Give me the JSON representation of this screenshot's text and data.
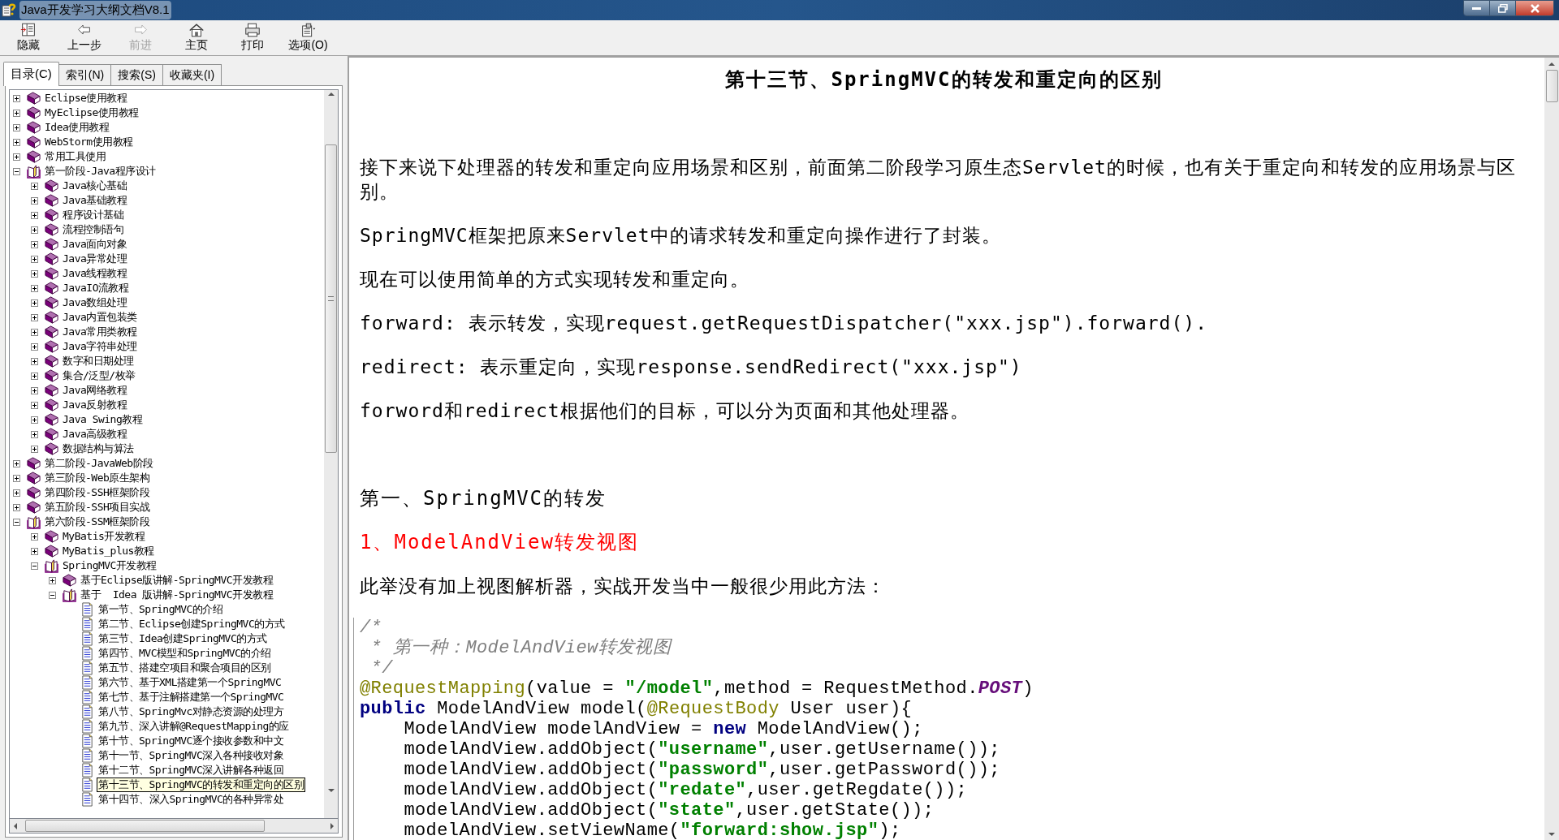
{
  "window": {
    "title": "Java开发学习大纲文档V8.1"
  },
  "toolbar": [
    {
      "kind": "hide",
      "label": "隐藏",
      "disabled": false
    },
    {
      "kind": "back",
      "label": "上一步",
      "disabled": false
    },
    {
      "kind": "forward",
      "label": "前进",
      "disabled": true
    },
    {
      "kind": "home",
      "label": "主页",
      "disabled": false
    },
    {
      "kind": "print",
      "label": "打印",
      "disabled": false
    },
    {
      "kind": "options",
      "label": "选项(O)",
      "disabled": false
    }
  ],
  "nav_tabs": [
    {
      "label": "目录(C)",
      "selected": true
    },
    {
      "label": "索引(N)",
      "selected": false
    },
    {
      "label": "搜索(S)",
      "selected": false
    },
    {
      "label": "收藏夹(I)",
      "selected": false
    }
  ],
  "tree": [
    {
      "label": "Eclipse使用教程",
      "kind": "book",
      "expanded": false,
      "selected": false
    },
    {
      "label": "MyEclipse使用教程",
      "kind": "book",
      "expanded": false,
      "selected": false
    },
    {
      "label": "Idea使用教程",
      "kind": "book",
      "expanded": false,
      "selected": false
    },
    {
      "label": "WebStorm使用教程",
      "kind": "book",
      "expanded": false,
      "selected": false
    },
    {
      "label": "常用工具使用",
      "kind": "book",
      "expanded": false,
      "selected": false
    },
    {
      "label": "第一阶段-Java程序设计",
      "kind": "book",
      "expanded": true,
      "selected": false,
      "children": [
        {
          "label": "Java核心基础",
          "kind": "book",
          "expanded": false,
          "selected": false
        },
        {
          "label": "Java基础教程",
          "kind": "book",
          "expanded": false,
          "selected": false
        },
        {
          "label": "程序设计基础",
          "kind": "book",
          "expanded": false,
          "selected": false
        },
        {
          "label": "流程控制语句",
          "kind": "book",
          "expanded": false,
          "selected": false
        },
        {
          "label": "Java面向对象",
          "kind": "book",
          "expanded": false,
          "selected": false
        },
        {
          "label": "Java异常处理",
          "kind": "book",
          "expanded": false,
          "selected": false
        },
        {
          "label": "Java线程教程",
          "kind": "book",
          "expanded": false,
          "selected": false
        },
        {
          "label": "JavaIO流教程",
          "kind": "book",
          "expanded": false,
          "selected": false
        },
        {
          "label": "Java数组处理",
          "kind": "book",
          "expanded": false,
          "selected": false
        },
        {
          "label": "Java内置包装类",
          "kind": "book",
          "expanded": false,
          "selected": false
        },
        {
          "label": "Java常用类教程",
          "kind": "book",
          "expanded": false,
          "selected": false
        },
        {
          "label": "Java字符串处理",
          "kind": "book",
          "expanded": false,
          "selected": false
        },
        {
          "label": "数字和日期处理",
          "kind": "book",
          "expanded": false,
          "selected": false
        },
        {
          "label": "集合/泛型/枚举",
          "kind": "book",
          "expanded": false,
          "selected": false
        },
        {
          "label": "Java网络教程",
          "kind": "book",
          "expanded": false,
          "selected": false
        },
        {
          "label": "Java反射教程",
          "kind": "book",
          "expanded": false,
          "selected": false
        },
        {
          "label": "Java Swing教程",
          "kind": "book",
          "expanded": false,
          "selected": false
        },
        {
          "label": "Java高级教程",
          "kind": "book",
          "expanded": false,
          "selected": false
        },
        {
          "label": "数据结构与算法",
          "kind": "book",
          "expanded": false,
          "selected": false
        }
      ]
    },
    {
      "label": "第二阶段-JavaWeb阶段",
      "kind": "book",
      "expanded": false,
      "selected": false
    },
    {
      "label": "第三阶段-Web原生架构",
      "kind": "book",
      "expanded": false,
      "selected": false
    },
    {
      "label": "第四阶段-SSH框架阶段",
      "kind": "book",
      "expanded": false,
      "selected": false
    },
    {
      "label": "第五阶段-SSH项目实战",
      "kind": "book",
      "expanded": false,
      "selected": false
    },
    {
      "label": "第六阶段-SSM框架阶段",
      "kind": "book",
      "expanded": true,
      "selected": false,
      "children": [
        {
          "label": "MyBatis开发教程",
          "kind": "book",
          "expanded": false,
          "selected": false
        },
        {
          "label": "MyBatis_plus教程",
          "kind": "book",
          "expanded": false,
          "selected": false
        },
        {
          "label": "SpringMVC开发教程",
          "kind": "book",
          "expanded": true,
          "selected": false,
          "children": [
            {
              "label": "基于Eclipse版讲解-SpringMVC开发教程",
              "kind": "book",
              "expanded": false,
              "selected": false
            },
            {
              "label": "基于  Idea 版讲解-SpringMVC开发教程",
              "kind": "book",
              "expanded": true,
              "selected": false,
              "children": [
                {
                  "label": "第一节、SpringMVC的介绍",
                  "kind": "page",
                  "selected": false
                },
                {
                  "label": "第二节、Eclipse创建SpringMVC的方式",
                  "kind": "page",
                  "selected": false
                },
                {
                  "label": "第三节、Idea创建SpringMVC的方式",
                  "kind": "page",
                  "selected": false
                },
                {
                  "label": "第四节、MVC模型和SpringMVC的介绍",
                  "kind": "page",
                  "selected": false
                },
                {
                  "label": "第五节、搭建空项目和聚合项目的区别",
                  "kind": "page",
                  "selected": false
                },
                {
                  "label": "第六节、基于XML搭建第一个SpringMVC",
                  "kind": "page",
                  "selected": false
                },
                {
                  "label": "第七节、基于注解搭建第一个SpringMVC",
                  "kind": "page",
                  "selected": false
                },
                {
                  "label": "第八节、SpringMvc对静态资源的处理方",
                  "kind": "page",
                  "selected": false
                },
                {
                  "label": "第九节、深入讲解@RequestMapping的应",
                  "kind": "page",
                  "selected": false
                },
                {
                  "label": "第十节、SpringMVC逐个接收参数和中文",
                  "kind": "page",
                  "selected": false
                },
                {
                  "label": "第十一节、SpringMVC深入各种接收对象",
                  "kind": "page",
                  "selected": false
                },
                {
                  "label": "第十二节、SpringMVC深入讲解各种返回",
                  "kind": "page",
                  "selected": false
                },
                {
                  "label": "第十三节、SpringMVC的转发和重定向的区别",
                  "kind": "page",
                  "selected": true
                },
                {
                  "label": "第十四节、深入SpringMVC的各种异常处",
                  "kind": "page",
                  "selected": false
                }
              ]
            }
          ]
        }
      ]
    }
  ],
  "content": {
    "title": "第十三节、SpringMVC的转发和重定向的区别",
    "blocks": [
      {
        "kind": "para",
        "text": "接下来说下处理器的转发和重定向应用场景和区别，前面第二阶段学习原生态Servlet的时候，也有关于重定向和转发的应用场景与区别。"
      },
      {
        "kind": "para",
        "text": "SpringMVC框架把原来Servlet中的请求转发和重定向操作进行了封装。"
      },
      {
        "kind": "para",
        "text": "现在可以使用简单的方式实现转发和重定向。"
      },
      {
        "kind": "para",
        "text": "forward: 表示转发，实现request.getRequestDispatcher(\"xxx.jsp\").forward()."
      },
      {
        "kind": "para",
        "text": "redirect: 表示重定向，实现response.sendRedirect(\"xxx.jsp\")"
      },
      {
        "kind": "para",
        "text": "forword和redirect根据他们的目标，可以分为页面和其他处理器。"
      },
      {
        "kind": "heading",
        "text": "第一、SpringMVC的转发"
      },
      {
        "kind": "subheading",
        "text": "1、ModelAndView转发视图"
      },
      {
        "kind": "para",
        "text": "此举没有加上视图解析器，实战开发当中一般很少用此方法："
      },
      {
        "kind": "code",
        "lines": [
          [
            {
              "kind": "comment",
              "text": "/*"
            }
          ],
          [
            {
              "kind": "comment",
              "text": " * 第一种：ModelAndView转发视图"
            }
          ],
          [
            {
              "kind": "comment",
              "text": " */"
            }
          ],
          [
            {
              "kind": "annotation",
              "text": "@RequestMapping"
            },
            {
              "kind": "plain",
              "text": "(value = "
            },
            {
              "kind": "string",
              "text": "\"/model\""
            },
            {
              "kind": "plain",
              "text": ",method = RequestMethod."
            },
            {
              "kind": "constant",
              "text": "POST"
            },
            {
              "kind": "plain",
              "text": ")"
            }
          ],
          [
            {
              "kind": "keyword",
              "text": "public"
            },
            {
              "kind": "plain",
              "text": " ModelAndView model("
            },
            {
              "kind": "annotation",
              "text": "@RequestBody"
            },
            {
              "kind": "plain",
              "text": " User user){"
            }
          ],
          [
            {
              "kind": "plain",
              "text": "    ModelAndView modelAndView = "
            },
            {
              "kind": "keyword",
              "text": "new"
            },
            {
              "kind": "plain",
              "text": " ModelAndView();"
            }
          ],
          [
            {
              "kind": "plain",
              "text": "    modelAndView.addObject("
            },
            {
              "kind": "string",
              "text": "\"username\""
            },
            {
              "kind": "plain",
              "text": ",user.getUsername());"
            }
          ],
          [
            {
              "kind": "plain",
              "text": "    modelAndView.addObject("
            },
            {
              "kind": "string",
              "text": "\"password\""
            },
            {
              "kind": "plain",
              "text": ",user.getPassword());"
            }
          ],
          [
            {
              "kind": "plain",
              "text": "    modelAndView.addObject("
            },
            {
              "kind": "string",
              "text": "\"redate\""
            },
            {
              "kind": "plain",
              "text": ",user.getRegdate());"
            }
          ],
          [
            {
              "kind": "plain",
              "text": "    modelAndView.addObject("
            },
            {
              "kind": "string",
              "text": "\"state\""
            },
            {
              "kind": "plain",
              "text": ",user.getState());"
            }
          ],
          [
            {
              "kind": "plain",
              "text": "    modelAndView.setViewName("
            },
            {
              "kind": "string",
              "text": "\"forward:show.jsp\""
            },
            {
              "kind": "plain",
              "text": ");"
            }
          ]
        ]
      }
    ]
  }
}
